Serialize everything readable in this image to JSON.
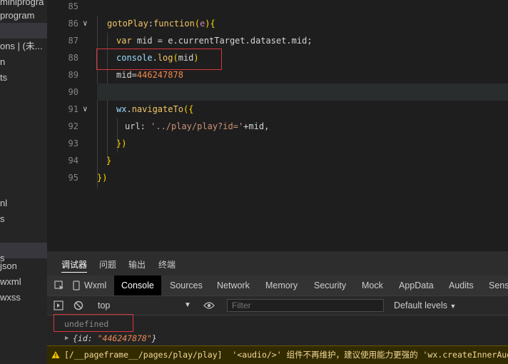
{
  "sidebar": {
    "items": [
      {
        "label": "miniprogra",
        "selected": false
      },
      {
        "label": "program",
        "selected": false
      },
      {
        "label": "",
        "selected": true
      },
      {
        "label": "ons | (未...",
        "selected": false
      },
      {
        "label": "n",
        "selected": false
      },
      {
        "label": "ts",
        "selected": false
      },
      {
        "label": "nl",
        "selected": false
      },
      {
        "label": "s",
        "selected": false
      },
      {
        "label": "s",
        "selected": true
      },
      {
        "label": "json",
        "selected": false
      },
      {
        "label": "wxml",
        "selected": false
      },
      {
        "label": "wxss",
        "selected": false
      }
    ]
  },
  "editor": {
    "lines": [
      {
        "num": "85",
        "parts": []
      },
      {
        "num": "86",
        "parts": [
          [
            "k",
            "gotoPlay"
          ],
          [
            "",
            "::"
          ],
          [
            "k",
            "function"
          ],
          [
            "p",
            "("
          ],
          [
            "pm",
            "e"
          ],
          [
            "p",
            "){"
          ]
        ]
      },
      {
        "num": "87",
        "parts": [
          [
            "k",
            "var"
          ],
          [
            "",
            " mid = e.currentTarget.dataset.mid;"
          ]
        ]
      },
      {
        "num": "88",
        "parts": [
          [
            "v",
            "console"
          ],
          [
            "",
            "."
          ],
          [
            "k",
            "log"
          ],
          [
            "p",
            "("
          ],
          [
            "",
            "mid"
          ],
          [
            "p",
            ")"
          ]
        ]
      },
      {
        "num": "89",
        "parts": [
          [
            "",
            "mid="
          ],
          [
            "n",
            "446247878"
          ]
        ]
      },
      {
        "num": "90",
        "parts": []
      },
      {
        "num": "91",
        "parts": [
          [
            "v",
            "wx"
          ],
          [
            "",
            "."
          ],
          [
            "k",
            "navigateTo"
          ],
          [
            "p",
            "({"
          ]
        ]
      },
      {
        "num": "92",
        "parts": [
          [
            "",
            "url: "
          ],
          [
            "s",
            "'../play/play?id='"
          ],
          [
            "",
            "+mid,"
          ]
        ]
      },
      {
        "num": "93",
        "parts": [
          [
            "p",
            "})"
          ]
        ]
      },
      {
        "num": "94",
        "parts": [
          [
            "p",
            "}"
          ]
        ]
      },
      {
        "num": "95",
        "parts": [
          [
            "p",
            "})"
          ]
        ]
      }
    ]
  },
  "devtools": {
    "top_tabs": [
      "调试器",
      "问题",
      "输出",
      "终端"
    ],
    "panel_tabs": [
      "Wxml",
      "Console",
      "Sources",
      "Network",
      "Memory",
      "Security",
      "Mock",
      "AppData",
      "Audits",
      "Sensor"
    ],
    "context": "top",
    "filter_placeholder": "Filter",
    "levels": "Default levels",
    "console": {
      "undefined": "undefined",
      "obj_prefix": "{id: ",
      "obj_value": "\"446247878\"",
      "obj_suffix": "}",
      "warning_path": "[/__pageframe__/pages/play/play]",
      "warning_text": "'<audio/>' 组件不再维护，建议使用能力更强的 'wx.createInnerAudioContext' 接口"
    }
  },
  "colors": {
    "accent_red": "#d9363e",
    "warning_bg": "#332b00",
    "keyword": "#f2c566",
    "number": "#f3884a"
  }
}
